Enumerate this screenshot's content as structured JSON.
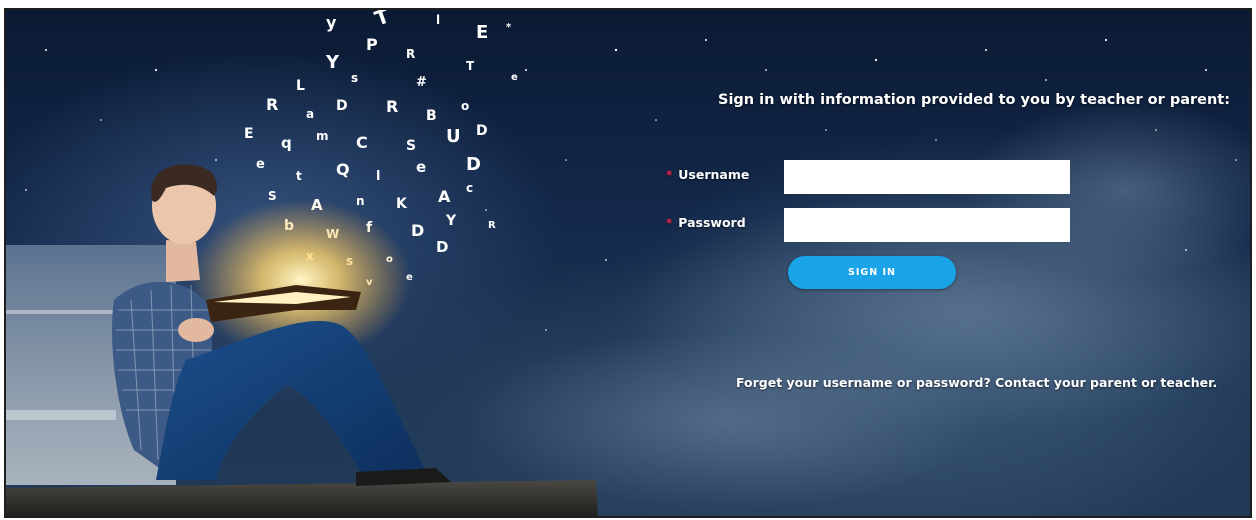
{
  "login": {
    "heading": "Sign in with information provided to you by teacher or parent:",
    "required_marker": "*",
    "username_label": "Username",
    "password_label": "Password",
    "username_value": "",
    "password_value": "",
    "signin_label": "SIGN IN",
    "forgot_text": "Forget your username or password? Contact your parent or teacher."
  },
  "colors": {
    "accent": "#1aa3e6",
    "required": "#e4224b",
    "sky_dark": "#0b1a33",
    "sky_light": "#3c5877"
  },
  "icons": {
    "hero": "reader-with-glowing-book-illustration"
  }
}
